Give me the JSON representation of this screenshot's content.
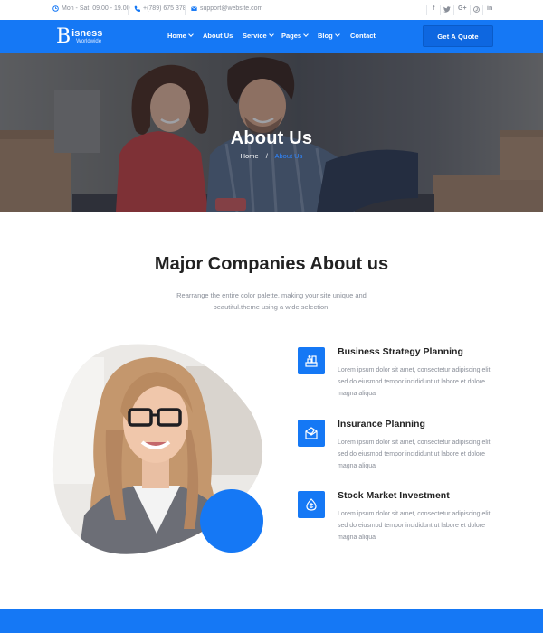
{
  "topbar": {
    "hours": "Mon - Sat: 09.00 - 19.00",
    "phone": "+(789) 675 378",
    "email": "support@website.com",
    "social": [
      "facebook-icon",
      "twitter-icon",
      "google-plus-icon",
      "pinterest-icon",
      "linkedin-icon"
    ],
    "google_plus_label": "G+",
    "linkedin_label": "in"
  },
  "nav": {
    "logo_mark": "B",
    "logo_name": "isness",
    "logo_sub": "Worldwide",
    "items": [
      {
        "label": "Home",
        "dropdown": true
      },
      {
        "label": "About Us",
        "dropdown": false
      },
      {
        "label": "Service",
        "dropdown": true
      },
      {
        "label": "Pages",
        "dropdown": true
      },
      {
        "label": "Blog",
        "dropdown": true
      },
      {
        "label": "Contact",
        "dropdown": false
      }
    ],
    "cta": "Get A Quote"
  },
  "hero": {
    "title": "About Us",
    "breadcrumb_home": "Home",
    "breadcrumb_sep": "/",
    "breadcrumb_current": "About Us"
  },
  "section": {
    "title": "Major Companies About us",
    "subtitle": "Rearrange the entire color palette, making your site unique and beautiful.theme using a wide selection."
  },
  "features": [
    {
      "title": "Business Strategy Planning",
      "text": "Lorem ipsum dolor sit amet, consectetur adipiscing elit, sed do eiusmod tempor incididunt ut labore et dolore magna aliqua",
      "icon": "strategy-icon"
    },
    {
      "title": "Insurance Planning",
      "text": "Lorem ipsum dolor sit amet, consectetur adipiscing elit, sed do eiusmod tempor incididunt ut labore et dolore magna aliqua",
      "icon": "insurance-icon"
    },
    {
      "title": "Stock Market Investment",
      "text": "Lorem ipsum dolor sit amet, consectetur adipiscing elit, sed do eiusmod tempor incididunt ut labore et dolore magna aliqua",
      "icon": "investment-icon"
    }
  ],
  "colors": {
    "accent": "#1578f5",
    "text": "#222222",
    "muted": "#8a8f99"
  }
}
